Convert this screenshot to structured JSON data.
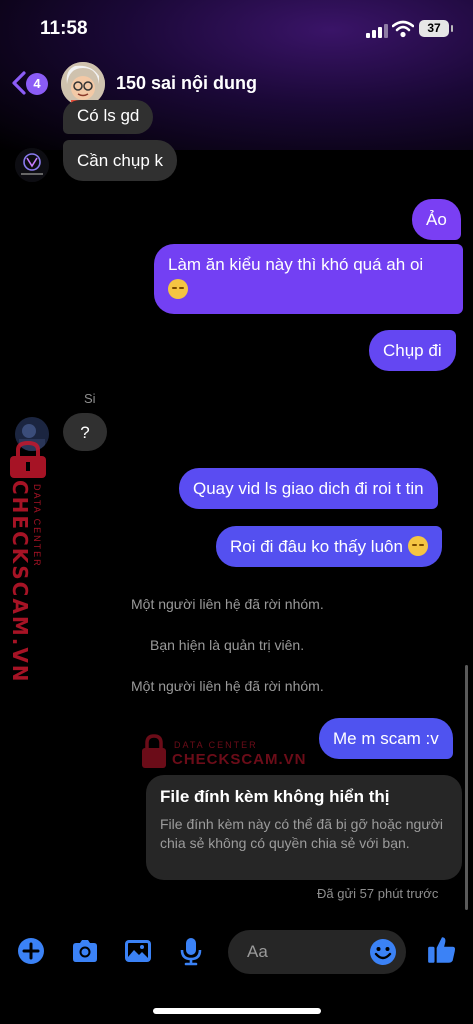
{
  "status": {
    "time": "11:58",
    "battery": "37"
  },
  "header": {
    "back_badge": "4",
    "title": "150 sai nội dung"
  },
  "messages": [
    {
      "id": "m1",
      "dir": "in",
      "text": "Có ls gd"
    },
    {
      "id": "m2",
      "dir": "in",
      "text": "Cần chụp k"
    },
    {
      "id": "m3",
      "dir": "out",
      "text": "Ảo"
    },
    {
      "id": "m4",
      "dir": "out",
      "text_line1": "Làm ăn kiểu này thì khó quá ah oi",
      "emoji": "pensive-face"
    },
    {
      "id": "m5",
      "dir": "out",
      "text": "Chụp đi"
    },
    {
      "id": "m6",
      "dir": "in",
      "sender": "Si",
      "text": "?"
    },
    {
      "id": "m7",
      "dir": "out",
      "text": "Quay vid ls giao dich đi roi t tin"
    },
    {
      "id": "m8",
      "dir": "out",
      "text": "Roi đi đâu ko thấy luôn",
      "emoji": "pensive-face"
    },
    {
      "id": "m9",
      "dir": "out",
      "text": "Me m scam :v"
    }
  ],
  "system_notes": [
    "Một người liên hệ đã rời nhóm.",
    "Bạn hiện là quản trị viên.",
    "Một người liên hệ đã rời nhóm."
  ],
  "attachment": {
    "title": "File đính kèm không hiển thị",
    "body": "File đính kèm này có thể đã bị gỡ hoặc người chia sẻ không có quyền chia sẻ với bạn."
  },
  "sent_status": "Đã gửi 57 phút trước",
  "composer": {
    "placeholder": "Aa",
    "icons": [
      "plus-icon",
      "camera-icon",
      "image-icon",
      "microphone-icon",
      "emoji-icon",
      "thumbs-up-icon"
    ]
  },
  "watermark": {
    "brand": "CHECKSCAM.VN",
    "tag": "DATA CENTER"
  },
  "colors": {
    "accent": "#8b5cf6",
    "bubble_out_top": "#7b3ff2",
    "bubble_out_bottom": "#4f53f0",
    "bubble_in": "#303030",
    "composer_icon": "#3b82f6",
    "watermark": "#c4172c"
  }
}
